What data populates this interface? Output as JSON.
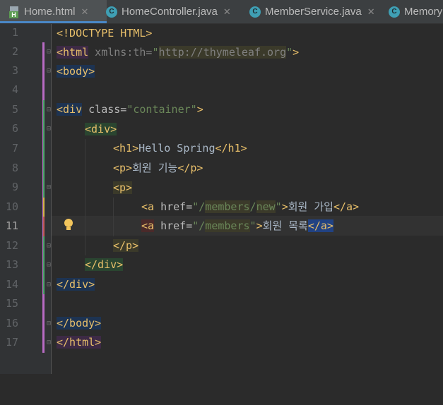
{
  "tabs": [
    {
      "label": "Home.html",
      "icon": "html-file-icon",
      "active": true
    },
    {
      "label": "HomeController.java",
      "icon": "java-class-icon",
      "active": false
    },
    {
      "label": "MemberService.java",
      "icon": "java-class-icon",
      "active": false
    },
    {
      "label": "Memory",
      "icon": "java-class-icon",
      "active": false
    }
  ],
  "line_numbers": [
    "1",
    "2",
    "3",
    "4",
    "5",
    "6",
    "7",
    "8",
    "9",
    "10",
    "11",
    "12",
    "13",
    "14",
    "15",
    "16",
    "17"
  ],
  "current_line": "11",
  "code": {
    "l1": "<!DOCTYPE HTML>",
    "l2_open": "<html",
    "l2_attr": " xmlns:th=",
    "l2_q1": "\"",
    "l2_url": "http://thymeleaf.org",
    "l2_q2": "\"",
    "l2_close": ">",
    "l3": "<body>",
    "l5_open": "<div",
    "l5_attr": " class=",
    "l5_val": "\"container\"",
    "l5_close": ">",
    "l6": "<div>",
    "l7_open": "<h1>",
    "l7_text": "Hello Spring",
    "l7_close": "</h1>",
    "l8_open": "<p>",
    "l8_text": "회원 기능",
    "l8_close": "</p>",
    "l9": "<p>",
    "l10_open": "<a",
    "l10_attr": " href=",
    "l10_q1": "\"/",
    "l10_seg1": "members",
    "l10_slash": "/",
    "l10_seg2": "new",
    "l10_q2": "\"",
    "l10_gt": ">",
    "l10_text": "회원 가입",
    "l10_close": "</a>",
    "l11_open": "<a",
    "l11_attr": " href=",
    "l11_q1": "\"/",
    "l11_seg1": "members",
    "l11_q2": "\"",
    "l11_gt": ">",
    "l11_text": "회원 목록",
    "l11_close": "</a>",
    "l12": "</p>",
    "l13": "</div>",
    "l14": "</div>",
    "l16": "</body>",
    "l17": "</html>"
  },
  "colors": {
    "background": "#2b2b2b",
    "tag": "#e8bf6a",
    "string": "#6a8759",
    "attribute": "#bababa",
    "text": "#a9b7c6",
    "active_tab_underline": "#4a88c7"
  }
}
